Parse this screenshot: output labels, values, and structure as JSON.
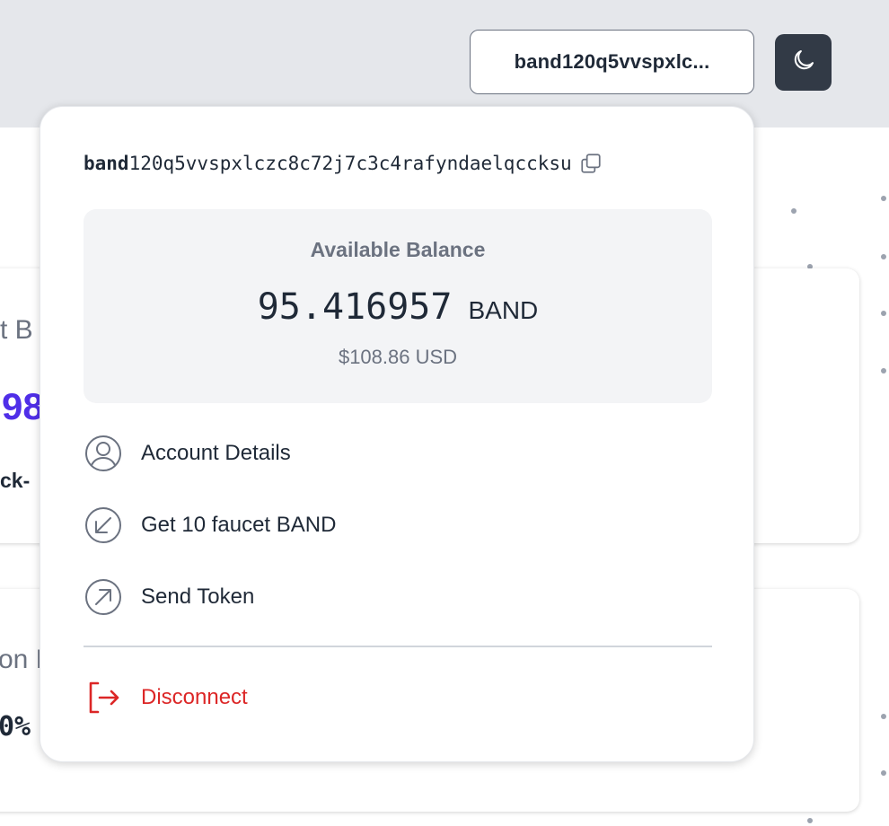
{
  "header": {
    "account_button_label": "band120q5vvspxlc...",
    "theme_toggle_icon": "moon-icon"
  },
  "background": {
    "card1_title_fragment": "t B",
    "card1_value_fragment": "98",
    "card1_sub_fragment": "ck-",
    "card2_title_fragment": "on P",
    "card2_value_fragment": "0%"
  },
  "wallet": {
    "address_prefix": "band",
    "address_rest": "120q5vvspxlczc8c72j7c3c4rafyndaelqccksu",
    "copy_icon": "copy-icon",
    "balance": {
      "title": "Available Balance",
      "amount": "95.416957",
      "unit": "BAND",
      "usd": "$108.86 USD"
    },
    "menu": [
      {
        "label": "Account Details",
        "icon": "user-circle-icon"
      },
      {
        "label": "Get 10 faucet BAND",
        "icon": "arrow-down-left-icon"
      },
      {
        "label": "Send Token",
        "icon": "arrow-up-right-icon"
      }
    ],
    "disconnect_label": "Disconnect",
    "disconnect_icon": "logout-icon"
  },
  "colors": {
    "accent_purple": "#4f2ee8",
    "danger": "#dc2626",
    "dark_button": "#323a46"
  }
}
